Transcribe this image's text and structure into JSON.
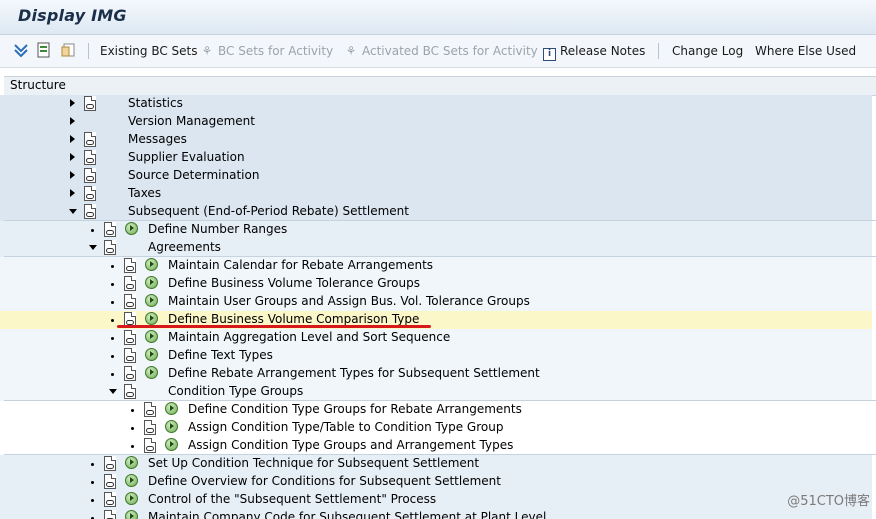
{
  "window": {
    "title": "Display IMG"
  },
  "toolbar": {
    "existing_bc_sets": "Existing BC Sets",
    "bc_sets_for_activity": "BC Sets for Activity",
    "activated_bc_sets_for_activity": "Activated BC Sets for Activity",
    "release_notes": "Release Notes",
    "change_log": "Change Log",
    "where_else_used": "Where Else Used"
  },
  "structure": {
    "header": "Structure"
  },
  "tree": {
    "n0": "Statistics",
    "n1": "Version Management",
    "n2": "Messages",
    "n3": "Supplier Evaluation",
    "n4": "Source Determination",
    "n5": "Taxes",
    "n6": "Subsequent (End-of-Period Rebate) Settlement",
    "n7": "Define Number Ranges",
    "n8": "Agreements",
    "n9": "Maintain Calendar for Rebate Arrangements",
    "n10": "Define Business Volume Tolerance Groups",
    "n11": "Maintain User Groups and Assign Bus. Vol. Tolerance Groups",
    "n12": "Define Business Volume Comparison Type",
    "n13": "Maintain Aggregation Level and Sort Sequence",
    "n14": "Define Text Types",
    "n15": "Define Rebate Arrangement Types for Subsequent Settlement",
    "n16": "Condition Type Groups",
    "n17": "Define Condition Type Groups for Rebate Arrangements",
    "n18": "Assign Condition Type/Table to Condition Type Group",
    "n19": "Assign Condition Type Groups and Arrangement Types",
    "n20": "Set Up Condition Technique for Subsequent Settlement",
    "n21": "Define Overview for Conditions for Subsequent Settlement",
    "n22": "Control of the \"Subsequent Settlement\" Process",
    "n23": "Maintain Company Code for Subsequent Settlement at Plant Level"
  },
  "watermark": "@51CTO博客",
  "colors": {
    "highlight": "#fbf7c9",
    "annotation_underline": "#d7191c"
  }
}
